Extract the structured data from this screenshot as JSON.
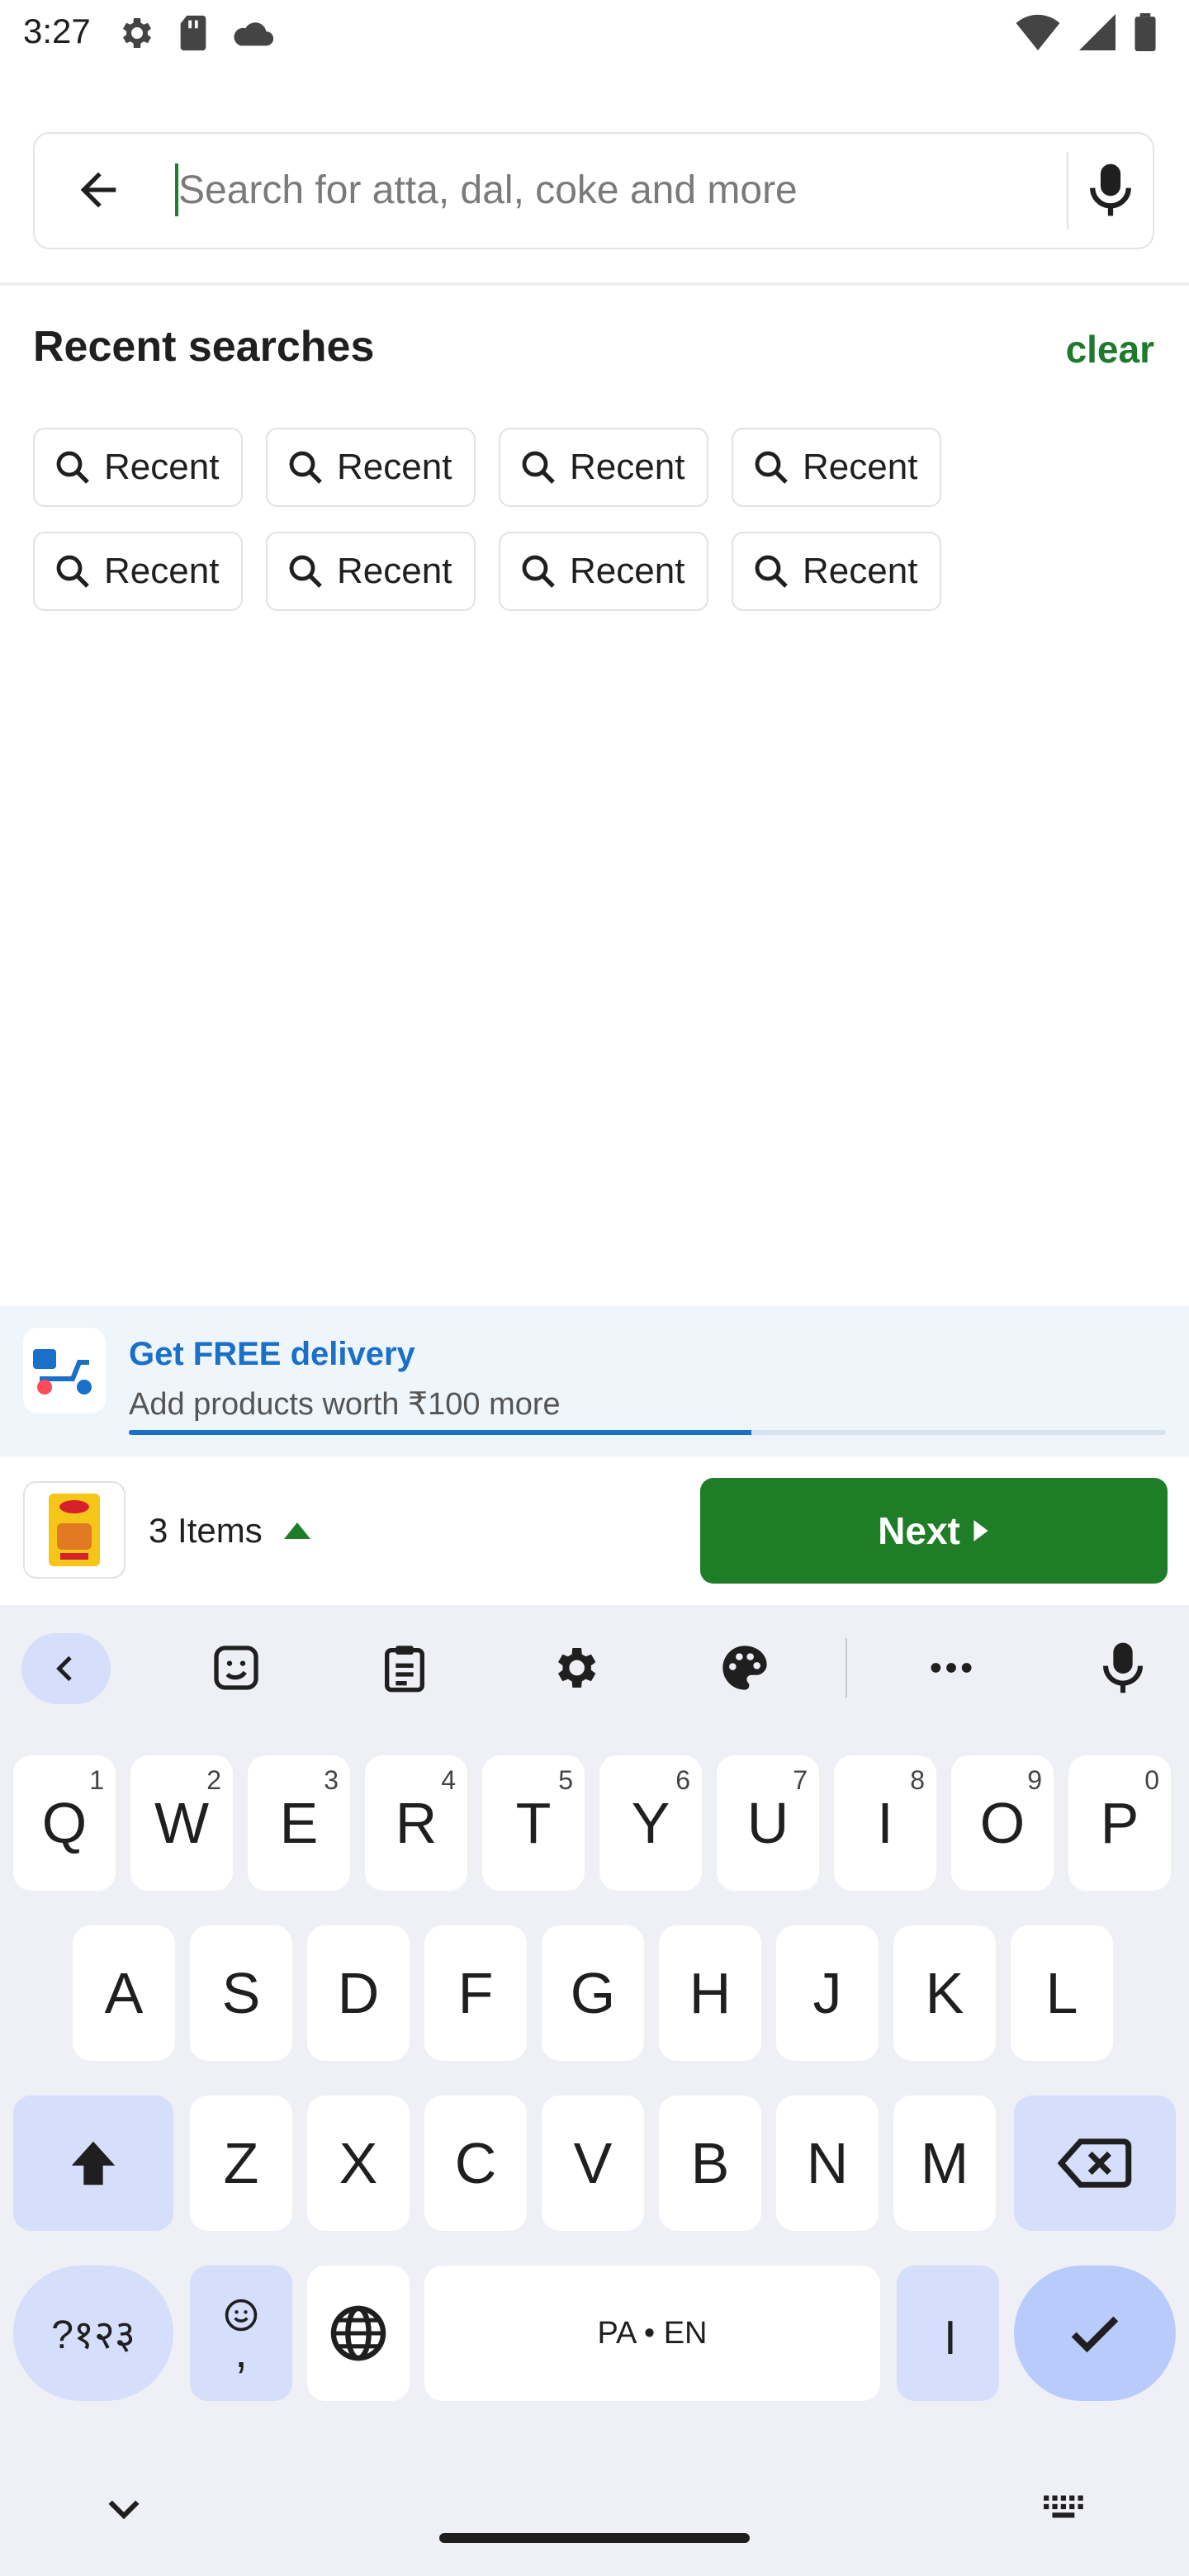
{
  "status_bar": {
    "time": "3:27"
  },
  "search": {
    "placeholder": "Search for atta, dal, coke and more",
    "value": ""
  },
  "recent": {
    "title": "Recent searches",
    "clear_label": "clear",
    "chips": [
      "Recent",
      "Recent",
      "Recent",
      "Recent",
      "Recent",
      "Recent",
      "Recent",
      "Recent"
    ]
  },
  "delivery_banner": {
    "title": "Get FREE delivery",
    "subtitle": "Add products worth ₹100 more",
    "progress": 0.6
  },
  "cart": {
    "items_label": "3 Items",
    "next_label": "Next"
  },
  "keyboard": {
    "row1": [
      {
        "k": "Q",
        "n": "1"
      },
      {
        "k": "W",
        "n": "2"
      },
      {
        "k": "E",
        "n": "3"
      },
      {
        "k": "R",
        "n": "4"
      },
      {
        "k": "T",
        "n": "5"
      },
      {
        "k": "Y",
        "n": "6"
      },
      {
        "k": "U",
        "n": "7"
      },
      {
        "k": "I",
        "n": "8"
      },
      {
        "k": "O",
        "n": "9"
      },
      {
        "k": "P",
        "n": "0"
      }
    ],
    "row2": [
      "A",
      "S",
      "D",
      "F",
      "G",
      "H",
      "J",
      "K",
      "L"
    ],
    "row3": [
      "Z",
      "X",
      "C",
      "V",
      "B",
      "N",
      "M"
    ],
    "symbols_label": "?१२३",
    "comma_label": ",",
    "space_label": "PA • EN",
    "danda_label": "।"
  },
  "colors": {
    "accent_green": "#1e7d26",
    "banner_blue": "#1a6fc9",
    "keyboard_bg": "#eef0f6"
  }
}
